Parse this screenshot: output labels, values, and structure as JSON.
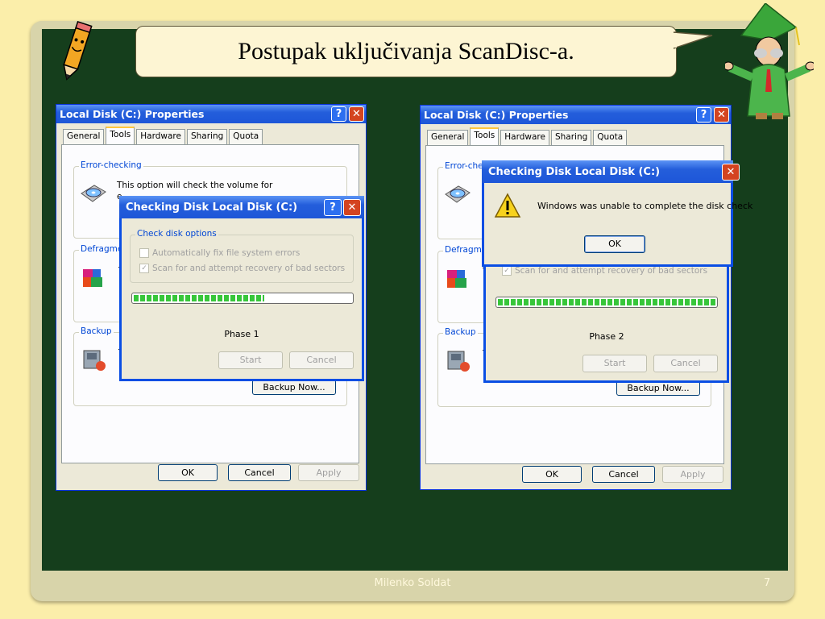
{
  "slide": {
    "title": "Postupak uključivanja ScanDisc-a.",
    "footer": "Milenko Soldat",
    "page_number": "7"
  },
  "left": {
    "window_title": "Local Disk (C:) Properties",
    "help": "?",
    "close": "✕",
    "tabs": [
      "General",
      "Tools",
      "Hardware",
      "Sharing",
      "Quota"
    ],
    "active_tab": "Tools",
    "error_checking": {
      "label": "Error-checking",
      "text": "This option will check the volume for",
      "text2": "e"
    },
    "defrag": {
      "label": "Defragme",
      "text": "T"
    },
    "backup": {
      "label": "Backup",
      "text": "T",
      "button": "Backup Now..."
    },
    "buttons": {
      "ok": "OK",
      "cancel": "Cancel",
      "apply": "Apply"
    },
    "dialog": {
      "title": "Checking Disk Local Disk (C:)",
      "group": "Check disk options",
      "opt1": "Automatically fix file system errors",
      "opt2": "Scan for and attempt recovery of bad sectors",
      "opt1_checked": false,
      "opt2_checked": true,
      "progress": 0.6,
      "phase": "Phase 1",
      "start": "Start",
      "cancel": "Cancel"
    }
  },
  "right": {
    "window_title": "Local Disk (C:) Properties",
    "help": "?",
    "close": "✕",
    "tabs": [
      "General",
      "Tools",
      "Hardware",
      "Sharing",
      "Quota"
    ],
    "active_tab": "Tools",
    "error_checking": {
      "label": "Error-che"
    },
    "defrag": {
      "label": "Defragme",
      "text": "T"
    },
    "backup": {
      "label": "Backup",
      "text": "T",
      "button": "Backup Now..."
    },
    "buttons": {
      "ok": "OK",
      "cancel": "Cancel",
      "apply": "Apply"
    },
    "dialog": {
      "opt2": "Scan for and attempt recovery of bad sectors",
      "progress": 1.0,
      "phase": "Phase 2",
      "start": "Start",
      "cancel": "Cancel"
    },
    "message": {
      "title": "Checking Disk Local Disk (C:)",
      "text": "Windows was unable to complete the disk check",
      "ok": "OK",
      "icon": "warning-icon"
    }
  },
  "colors": {
    "board": "#153e1c",
    "xp_blue": "#245edb",
    "background": "#fbeeaa"
  }
}
